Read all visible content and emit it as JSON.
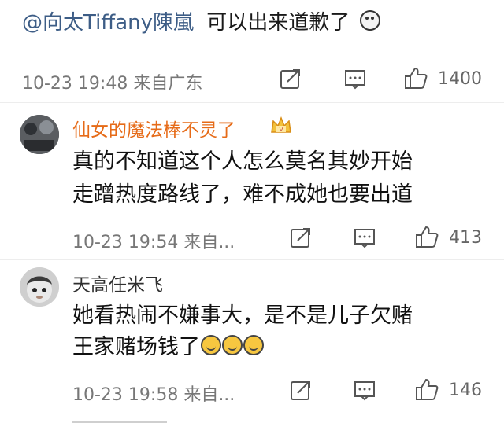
{
  "post": {
    "mention": "@向太Tiffany陳嵐",
    "text": "可以出来道歉了",
    "meta": "10-23 19:48 来自广东",
    "like_count": "1400"
  },
  "comments": [
    {
      "username": "仙女的魔法棒不灵了",
      "badge": "crown-badge-icon",
      "line1": "真的不知道这个人怎么莫名其妙开始",
      "line2": "走蹭热度路线了，难不成她也要出道",
      "meta": "10-23 19:54 来自...",
      "like_count": "413"
    },
    {
      "username": "天高任米飞",
      "line1": "她看热闹不嫌事大，是不是儿子欠赌",
      "line2": "王家赌场钱了",
      "emoji": "laughing-emoji",
      "meta": "10-23 19:58 来自...",
      "like_count": "146"
    }
  ],
  "colors": {
    "mention": "#3d5d86",
    "vip_username": "#e66b18",
    "meta": "#777777"
  }
}
